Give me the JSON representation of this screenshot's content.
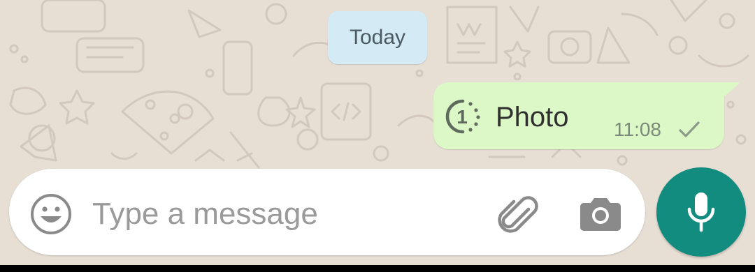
{
  "chat": {
    "date_divider": "Today",
    "messages": [
      {
        "text": "Photo",
        "time": "11:08",
        "status_icon": "single-check-icon",
        "media_icon": "view-once-icon",
        "view_once_badge": "1"
      }
    ]
  },
  "composer": {
    "placeholder": "Type a message",
    "value": "",
    "emoji_icon": "emoji-icon",
    "attach_icon": "paperclip-icon",
    "camera_icon": "camera-icon",
    "mic_icon": "mic-icon"
  },
  "colors": {
    "wallpaper": "#e7ded4",
    "date_chip": "#d4eaf4",
    "outgoing_bubble": "#dcf8c6",
    "accent": "#128c7e"
  }
}
